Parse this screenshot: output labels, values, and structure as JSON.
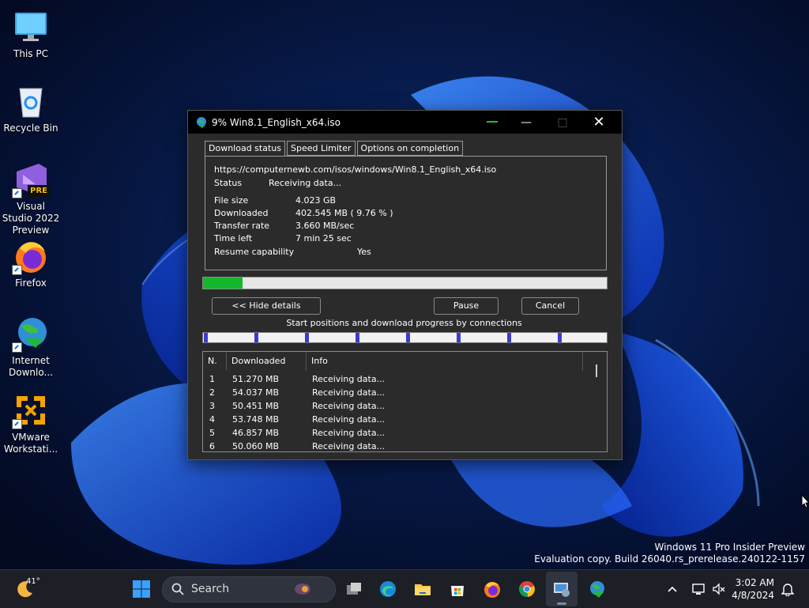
{
  "desktop": {
    "icons": [
      {
        "label": "This PC"
      },
      {
        "label": "Recycle Bin"
      },
      {
        "label": "Visual Studio 2022 Preview",
        "badge": "PRE"
      },
      {
        "label": "Firefox"
      },
      {
        "label": "Internet Downlo..."
      },
      {
        "label": "VMware Workstati..."
      }
    ],
    "watermark": {
      "line1": "Windows 11 Pro Insider Preview",
      "line2": "Evaluation copy. Build 26040.rs_prerelease.240122-1157"
    }
  },
  "window": {
    "title": "9% Win8.1_English_x64.iso",
    "tabs": [
      "Download status",
      "Speed Limiter",
      "Options on completion"
    ],
    "url": "https://computernewb.com/isos/windows/Win8.1_English_x64.iso",
    "status": {
      "label": "Status",
      "value": "Receiving data..."
    },
    "file_size": {
      "label": "File size",
      "value": "4.023  GB"
    },
    "downloaded": {
      "label": "Downloaded",
      "value": "402.545  MB  ( 9.76 % )"
    },
    "transfer_rate": {
      "label": "Transfer rate",
      "value": "3.660  MB/sec"
    },
    "time_left": {
      "label": "Time left",
      "value": "7 min 25 sec"
    },
    "resume": {
      "label": "Resume capability",
      "value": "Yes"
    },
    "progress_percent": 9.76,
    "buttons": {
      "hide_details": "<< Hide details",
      "pause": "Pause",
      "cancel": "Cancel"
    },
    "connections_label": "Start positions and download progress by connections",
    "table": {
      "headers": [
        "N.",
        "Downloaded",
        "Info"
      ],
      "rows": [
        [
          "1",
          "51.270  MB",
          "Receiving data..."
        ],
        [
          "2",
          "54.037  MB",
          "Receiving data..."
        ],
        [
          "3",
          "50.451  MB",
          "Receiving data..."
        ],
        [
          "4",
          "53.748  MB",
          "Receiving data..."
        ],
        [
          "5",
          "46.857  MB",
          "Receiving data..."
        ],
        [
          "6",
          "50.060  MB",
          "Receiving data..."
        ]
      ]
    }
  },
  "taskbar": {
    "temperature": "41°",
    "search_label": "Search",
    "time": "3:02 AM",
    "date": "4/8/2024"
  }
}
